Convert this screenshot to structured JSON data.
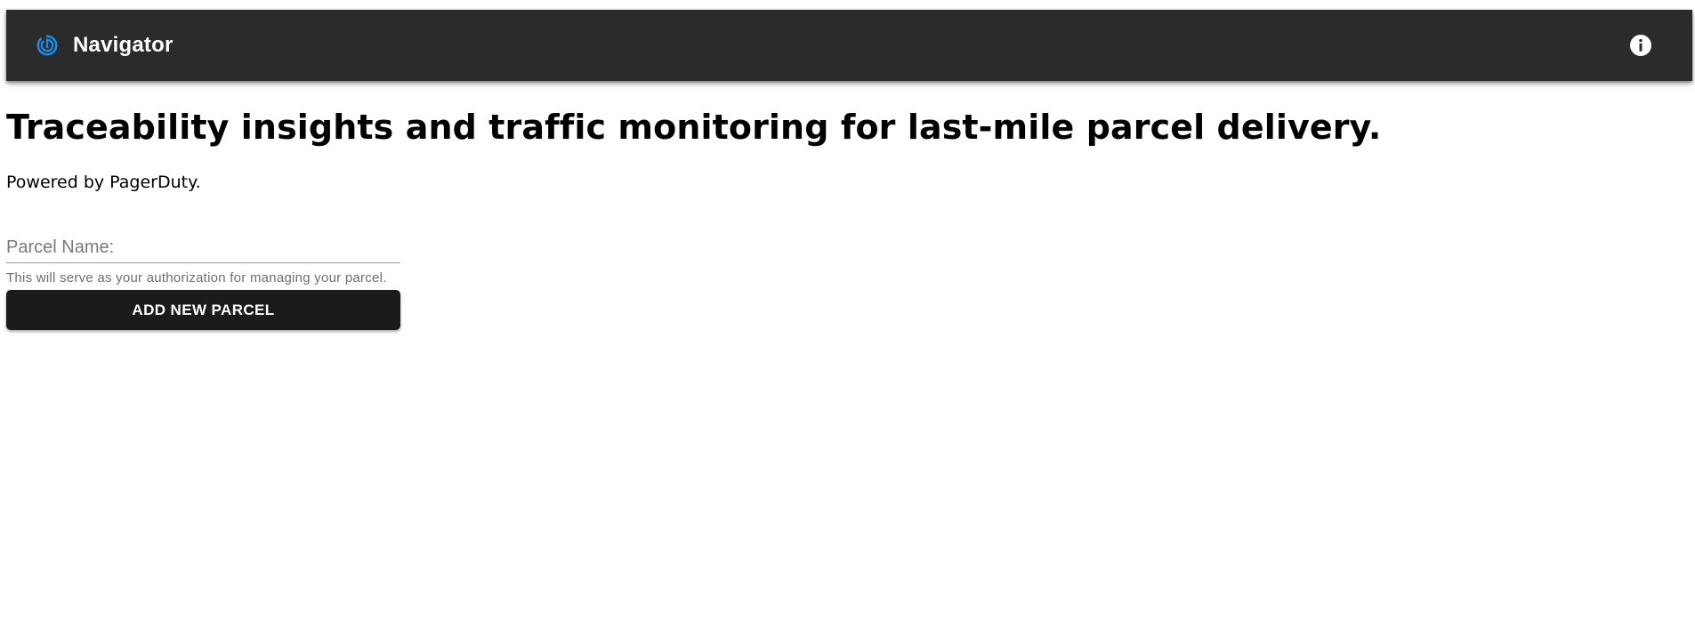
{
  "header": {
    "app_name": "Navigator",
    "logo_icon": "radar-icon",
    "info_icon": "info-icon",
    "logo_color": "#1e88e5",
    "bar_color": "#2b2b2b"
  },
  "main": {
    "headline": "Traceability insights and traffic monitoring for last-mile parcel delivery.",
    "powered_by": "Powered by PagerDuty.",
    "parcel_field": {
      "placeholder": "Parcel Name:",
      "value": "",
      "hint": "This will serve as your authorization for managing your parcel."
    },
    "add_button_label": "ADD NEW PARCEL",
    "button_color": "#1b1b1e"
  }
}
